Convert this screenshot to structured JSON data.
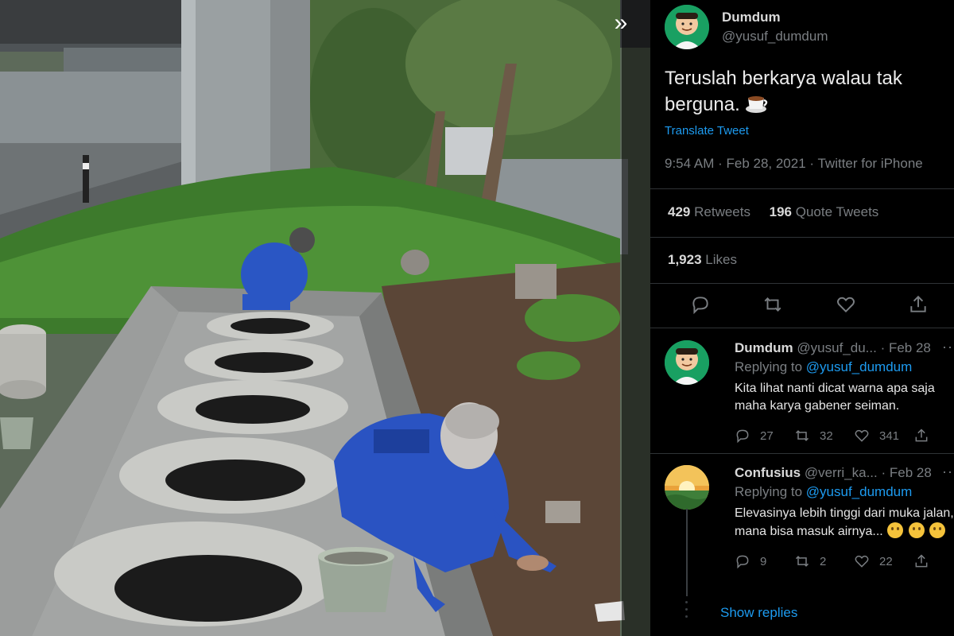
{
  "photo": {
    "icon": "double-chevron-right-icon",
    "collapse_glyph": "»"
  },
  "tweet": {
    "name": "Dumdum",
    "handle": "@yusuf_dumdum",
    "text": "Teruslah berkarya walau tak berguna.",
    "translate_label": "Translate Tweet",
    "meta": "9:54 AM · Feb 28, 2021 · Twitter for iPhone",
    "retweets_count": "429",
    "retweets_label": "Retweets",
    "quotes_count": "196",
    "quotes_label": "Quote Tweets",
    "likes_count": "1,923",
    "likes_label": "Likes",
    "actions": [
      "reply-icon",
      "retweet-icon",
      "like-icon",
      "share-icon"
    ]
  },
  "replies": [
    {
      "name": "Dumdum",
      "handle": "@yusuf_du...",
      "date": "· Feb 28",
      "replying_prefix": "Replying to",
      "replying_to": "@yusuf_dumdum",
      "text": "Kita lihat nanti dicat warna apa saja maha karya gabener seiman.",
      "reply_count": "27",
      "retweet_count": "32",
      "like_count": "341"
    },
    {
      "name": "Confusius",
      "handle": "@verri_ka...",
      "date": "· Feb 28",
      "replying_prefix": "Replying to",
      "replying_to": "@yusuf_dumdum",
      "text": "Elevasinya lebih tinggi dari muka jalan, mana bisa masuk airnya...",
      "reply_count": "9",
      "retweet_count": "2",
      "like_count": "22"
    }
  ],
  "show_replies": "Show replies",
  "colors": {
    "link": "#1d9bf0",
    "muted": "#7a7e82",
    "background": "#000000"
  }
}
